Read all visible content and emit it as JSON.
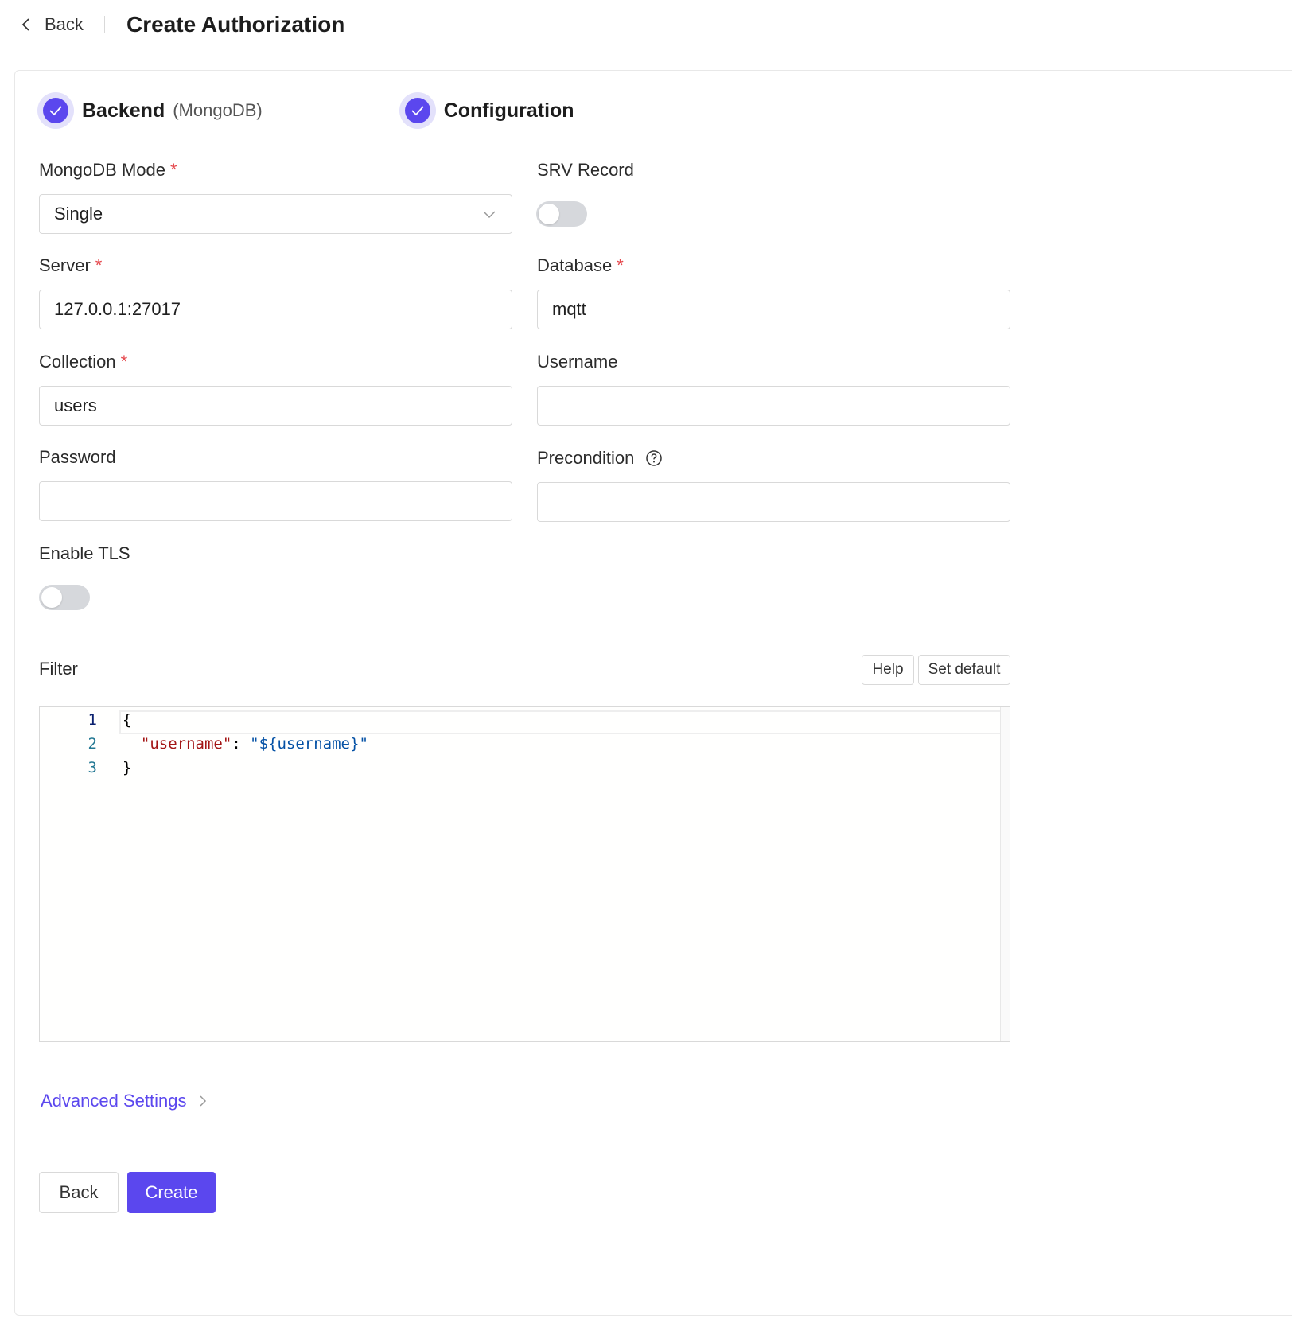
{
  "header": {
    "back_label": "Back",
    "title": "Create Authorization"
  },
  "steps": [
    {
      "title": "Backend",
      "description": "(MongoDB)",
      "status": "done"
    },
    {
      "title": "Configuration",
      "description": "",
      "status": "done"
    }
  ],
  "form": {
    "mongodb_mode": {
      "label": "MongoDB Mode",
      "required": "*",
      "value": "Single"
    },
    "srv_record": {
      "label": "SRV Record",
      "enabled": false
    },
    "server": {
      "label": "Server",
      "required": "*",
      "value": "127.0.0.1:27017"
    },
    "database": {
      "label": "Database",
      "required": "*",
      "value": "mqtt"
    },
    "collection": {
      "label": "Collection",
      "required": "*",
      "value": "users"
    },
    "username": {
      "label": "Username",
      "value": ""
    },
    "password": {
      "label": "Password",
      "value": ""
    },
    "precondition": {
      "label": "Precondition",
      "value": ""
    },
    "enable_tls": {
      "label": "Enable TLS",
      "enabled": false
    }
  },
  "filter": {
    "label": "Filter",
    "help_label": "Help",
    "set_default_label": "Set default",
    "line_numbers": [
      "1",
      "2",
      "3"
    ],
    "code": {
      "line1": "{",
      "indent": "  ",
      "key": "\"username\"",
      "colon": ": ",
      "value": "\"${username}\"",
      "line3": "}"
    }
  },
  "advanced_settings_label": "Advanced Settings",
  "actions": {
    "back_label": "Back",
    "create_label": "Create"
  },
  "colors": {
    "accent": "#5b47ee",
    "required": "#e5484d",
    "json_key": "#a31515",
    "json_string": "#0451a5"
  },
  "icons": {
    "back": "chevron-left-icon",
    "step_done": "check-icon",
    "select": "chevron-down-icon",
    "precondition_help": "question-circle-icon",
    "advanced": "chevron-right-icon"
  }
}
